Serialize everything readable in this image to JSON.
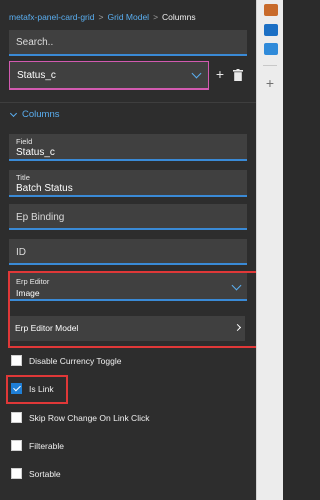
{
  "breadcrumb": {
    "items": [
      "metafx-panel-card-grid",
      "Grid Model",
      "Columns"
    ],
    "separator": ">"
  },
  "search": {
    "placeholder": "Search.."
  },
  "column_select": {
    "value": "Status_c"
  },
  "toolbar": {
    "add_label": "+"
  },
  "section": {
    "title": "Columns"
  },
  "fields": {
    "field": {
      "label": "Field",
      "value": "Status_c"
    },
    "title": {
      "label": "Title",
      "value": "Batch Status"
    },
    "ep_binding": {
      "placeholder": "Ep Binding"
    },
    "id": {
      "placeholder": "ID"
    },
    "erp_editor": {
      "label": "Erp Editor",
      "value": "Image"
    },
    "erp_editor_model": {
      "label": "Erp Editor Model"
    }
  },
  "checkboxes": [
    {
      "label": "Disable Currency Toggle",
      "checked": false
    },
    {
      "label": "Is Link",
      "checked": true
    },
    {
      "label": "Skip Row Change On Link Click",
      "checked": false
    },
    {
      "label": "Filterable",
      "checked": false
    },
    {
      "label": "Sortable",
      "checked": false
    }
  ],
  "rail": {
    "add_label": "+"
  },
  "colors": {
    "accent": "#5aaef0",
    "checkbox_checked": "#1f7fd6",
    "highlight": "#e03838",
    "select_border": "#d25ab0"
  }
}
